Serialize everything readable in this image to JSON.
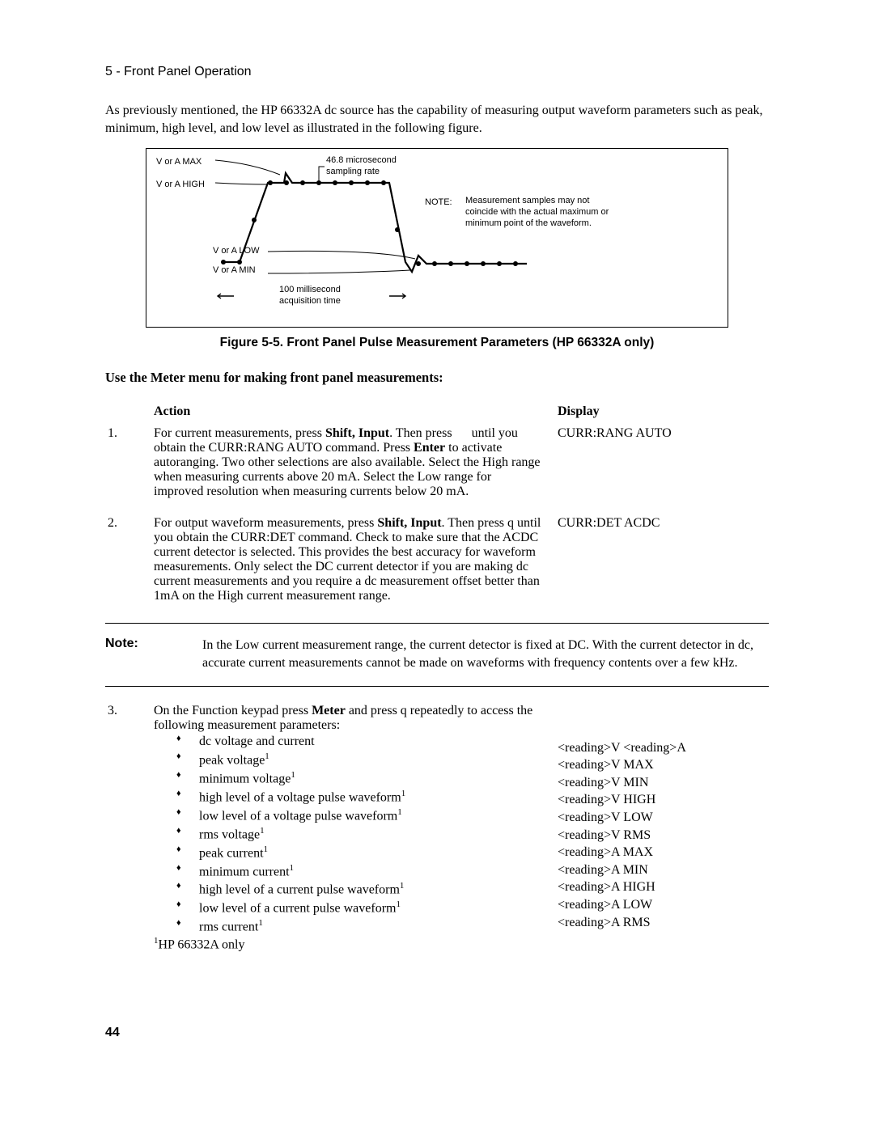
{
  "header": "5 - Front Panel Operation",
  "intro": "As previously mentioned, the HP 66332A dc source has the capability of measuring output waveform parameters such as peak, minimum, high level, and low level as illustrated in the following figure.",
  "figure": {
    "labels": {
      "max": "V or A MAX",
      "high": "V or A HIGH",
      "low": "V or A LOW",
      "min": "V or A MIN",
      "sampling": "46.8 microsecond sampling rate",
      "note_label": "NOTE:",
      "note_text": "Measurement samples may not coincide with the actual maximum or minimum point of the waveform.",
      "acq": "100 millisecond acquisition time"
    },
    "caption": "Figure 5-5. Front Panel Pulse Measurement Parameters (HP 66332A only)"
  },
  "subheading": "Use the Meter menu for making front panel measurements:",
  "cols": {
    "action": "Action",
    "display": "Display"
  },
  "steps": {
    "s1": {
      "num": "1.",
      "pre": "For current measurements, press ",
      "b1": "Shift, Input",
      "mid1": ". Then press ",
      "key1": "▲",
      "mid2": " until you obtain the CURR:RANG AUTO command. Press ",
      "b2": "Enter",
      "post": " to activate autoranging. Two other selections are also available. Select the High range when measuring currents above 20 mA. Select the Low range for improved resolution when measuring currents below 20 mA.",
      "display": "CURR:RANG AUTO"
    },
    "s2": {
      "num": "2.",
      "pre": "For output waveform measurements, press ",
      "b1": "Shift, Input",
      "mid1": ". Then press q until you obtain the CURR:DET command. Check to make sure that the ACDC current detector is selected. This provides the best accuracy for waveform measurements. Only select the DC current detector if you are making dc current measurements and you require a dc measurement offset better than 1mA on the High current measurement range.",
      "display": "CURR:DET ACDC"
    },
    "s3": {
      "num": "3.",
      "pre": "On the Function keypad press ",
      "b1": "Meter",
      "post": " and press q   repeatedly to access the following measurement parameters:",
      "bullets": [
        {
          "label": "dc voltage and current",
          "sup": false,
          "disp": "<reading>V   <reading>A"
        },
        {
          "label": "peak voltage",
          "sup": true,
          "disp": "<reading>V MAX"
        },
        {
          "label": "minimum voltage",
          "sup": true,
          "disp": "<reading>V MIN"
        },
        {
          "label": "high level of a voltage pulse waveform",
          "sup": true,
          "disp": "<reading>V HIGH"
        },
        {
          "label": "low level of a voltage pulse waveform",
          "sup": true,
          "disp": "<reading>V LOW"
        },
        {
          "label": "rms voltage",
          "sup": true,
          "disp": "<reading>V RMS"
        },
        {
          "label": "peak current",
          "sup": true,
          "disp": "<reading>A MAX"
        },
        {
          "label": "minimum current",
          "sup": true,
          "disp": "<reading>A MIN"
        },
        {
          "label": "high level of a current pulse waveform",
          "sup": true,
          "disp": "<reading>A HIGH"
        },
        {
          "label": "low level of a current pulse waveform",
          "sup": true,
          "disp": "<reading>A LOW"
        },
        {
          "label": "rms current",
          "sup": true,
          "disp": "<reading>A RMS"
        }
      ],
      "footnote_sup": "1",
      "footnote": "HP 66332A only"
    }
  },
  "note": {
    "label": "Note:",
    "text": "In the Low current measurement range, the current detector is fixed at DC. With the current detector in dc, accurate current measurements cannot be made on waveforms with frequency contents over a few kHz."
  },
  "page_number": "44"
}
